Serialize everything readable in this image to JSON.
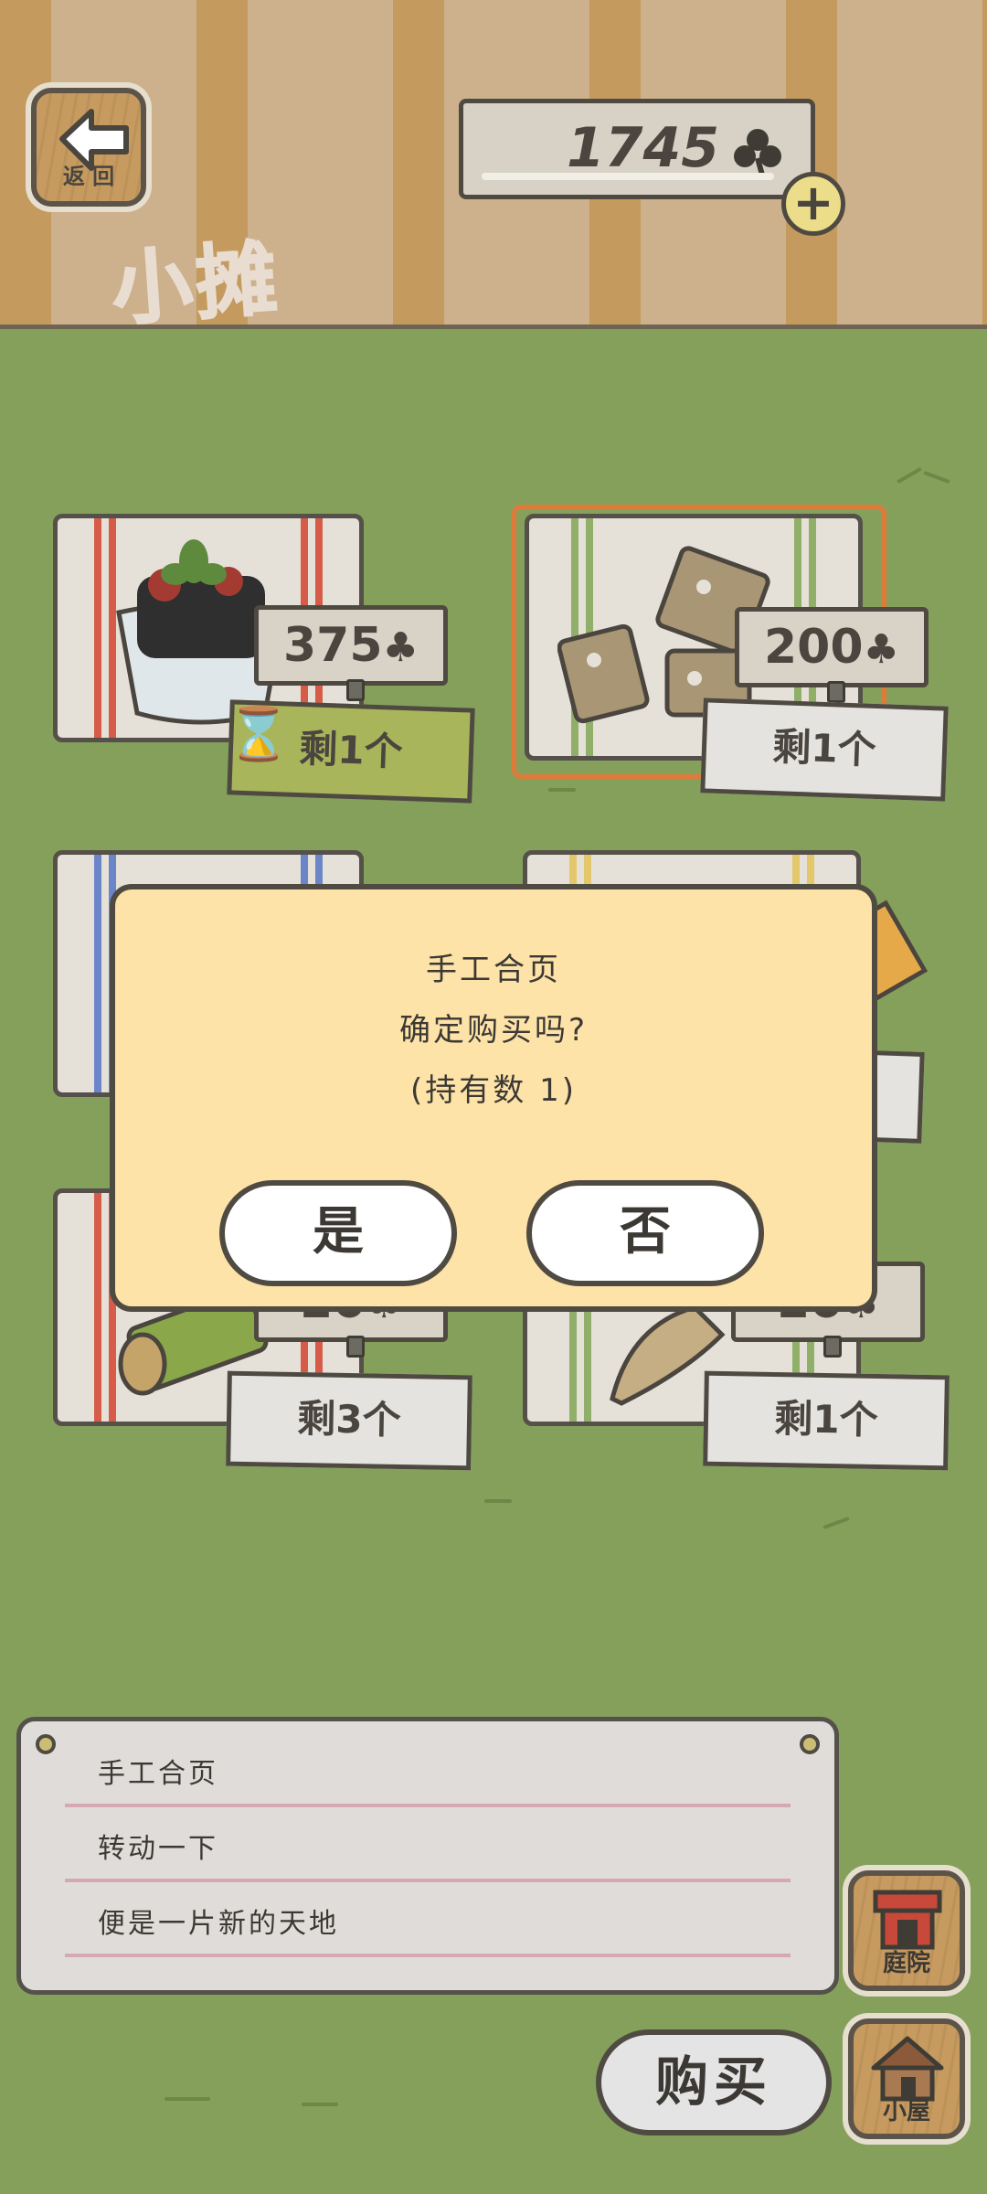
{
  "header": {
    "back_label": "返 回",
    "title": "小摊",
    "coin_balance": "1745",
    "coin_plus": "+"
  },
  "shop": {
    "items": [
      {
        "price": "375",
        "stock": "剩1个",
        "timed": true
      },
      {
        "price": "200",
        "stock": "剩1个",
        "selected": true
      },
      {
        "price": "",
        "stock": ""
      },
      {
        "price": "",
        "stock": "个"
      },
      {
        "price": "20",
        "stock": "剩3个"
      },
      {
        "price": "20",
        "stock": "剩1个"
      }
    ]
  },
  "dialog": {
    "item_name": "手工合页",
    "question": "确定购买吗?",
    "owned": "(持有数 1)",
    "yes_label": "是",
    "no_label": "否"
  },
  "description": {
    "name": "手工合页",
    "line1": "转动一下",
    "line2": "便是一片新的天地"
  },
  "buy_label": "购买",
  "nav": {
    "yard_label": "庭院",
    "house_label": "小屋"
  },
  "colors": {
    "grass": "#84a05b",
    "dialog_bg": "#fde3a7",
    "selected_border": "#e07a3a",
    "timed_tag": "#a9b55a"
  },
  "icons": {
    "currency": "clover-icon",
    "back": "arrow-left-icon",
    "timer": "hourglass-icon"
  }
}
